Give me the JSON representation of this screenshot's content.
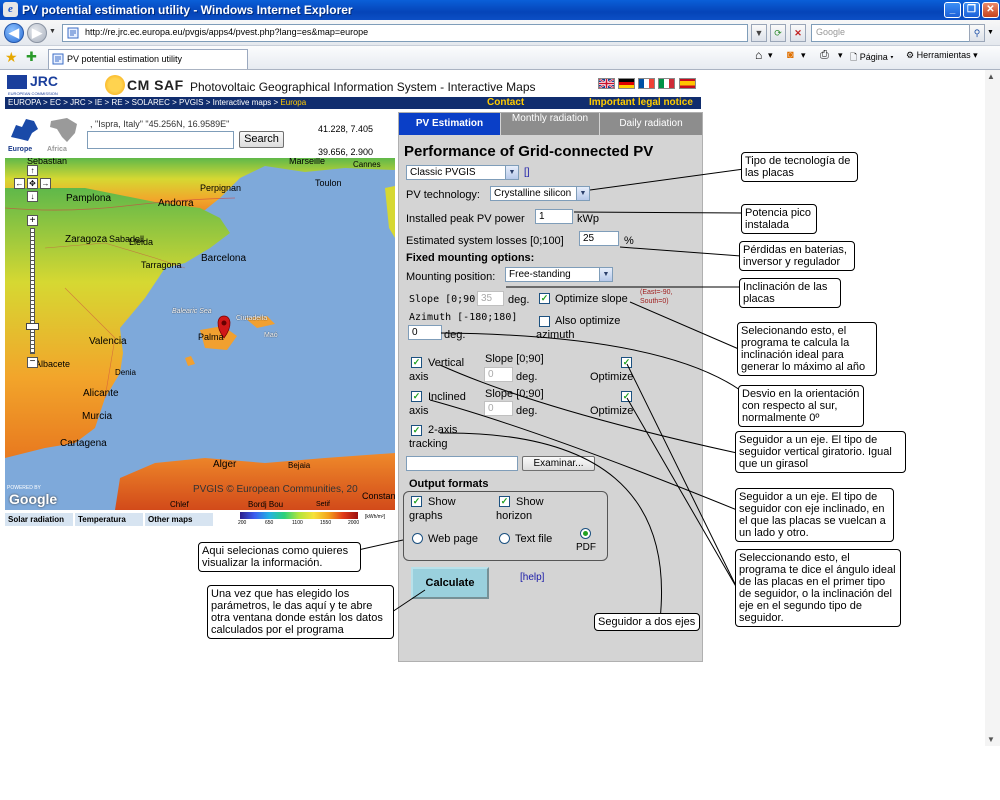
{
  "window": {
    "title": "PV potential estimation utility - Windows Internet Explorer",
    "url": "http://re.jrc.ec.europa.eu/pvgis/apps4/pvest.php?lang=es&map=europe",
    "search_placeholder": "Google",
    "tab_title": "PV potential estimation utility",
    "toolbar": {
      "page": "Página",
      "tools": "Herramientas"
    }
  },
  "header": {
    "jrc": "JRC",
    "jrc_sub": "EUROPEAN COMMISSION",
    "cmsaf": "CM SAF",
    "title": "Photovoltaic Geographical Information System - Interactive Maps",
    "breadcrumb": "EUROPA > EC > JRC > IE > RE > SOLAREC > PVGIS > Interactive maps > ",
    "breadcrumb_current": "Europa",
    "contact": "Contact",
    "legal": "Important legal notice"
  },
  "map_panel": {
    "region_europe": "Europe",
    "region_africa": "Africa",
    "search_hint": ", \"Ispra, Italy\" \"45.256N, 16.9589E\"",
    "search_button": "Search",
    "coord_top": "41.228, 7.405",
    "coord_bottom": "39.656, 2.900",
    "places": [
      "Sabadell",
      "Barcelona",
      "Andorra",
      "Zaragoza",
      "Lleida",
      "Tarragona",
      "Perpignan",
      "Toulon",
      "Pamplona",
      "Valencia",
      "Palma",
      "Ciutadella",
      "Maó",
      "Alicante",
      "Murcia",
      "Cartagena",
      "Albacete",
      "Denia",
      "Alger",
      "Bejaia",
      "Constan",
      "Chlef",
      "Bordj Bou",
      "Setif",
      "Balearic Sea",
      "Marseille",
      "Cannes",
      "Sebastian"
    ],
    "copyright": "PVGIS © European Communities, 20",
    "powered": "POWERED BY",
    "google": "Google",
    "tabs": [
      "Solar radiation",
      "Temperatura",
      "Other maps"
    ],
    "scale": [
      "200",
      "650",
      "1100",
      "1550",
      "2000",
      "[kWh/m²]"
    ]
  },
  "form": {
    "tabs": [
      "PV Estimation",
      "Monthly radiation",
      "Daily radiation"
    ],
    "title": "Performance of Grid-connected PV",
    "database": "Classic PVGIS",
    "database_help": "[]",
    "pv_technology_label": "PV technology:",
    "pv_technology": "Crystalline silicon",
    "peak_power_label": "Installed peak PV power",
    "peak_power": "1",
    "peak_power_unit": "kWp",
    "losses_label": "Estimated system losses [0;100]",
    "losses": "25",
    "losses_unit": "%",
    "fixed_header": "Fixed mounting options:",
    "mounting_label": "Mounting position:",
    "mounting": "Free-standing",
    "slope_label": "Slope [0;90]",
    "slope": "35",
    "deg": "deg.",
    "optimize_slope": "Optimize slope",
    "east_note_1": "(East=-90,",
    "east_note_2": "South=0)",
    "azimuth_label": "Azimuth [-180;180]",
    "azimuth": "0",
    "also_optimize": "Also optimize",
    "azimuth_word": "azimuth",
    "vertical_1": "Vertical",
    "vertical_2": "axis",
    "inclined_1": "Inclined",
    "inclined_2": "axis",
    "slope_short": "Slope [0;90]",
    "vert_slope": "0",
    "incl_slope": "0",
    "optimize": "Optimize",
    "twoaxis_1": "2-axis",
    "twoaxis_2": "tracking",
    "browse": "Examinar...",
    "output_header": "Output formats",
    "show_graphs_1": "Show",
    "show_graphs_2": "graphs",
    "show_horizon_1": "Show",
    "show_horizon_2": "horizon",
    "web_page": "Web page",
    "text_file": "Text file",
    "pdf": "PDF",
    "calculate": "Calculate",
    "help": "[help]"
  },
  "annotations": {
    "tech": "Tipo de tecnología de las placas",
    "peak": "Potencia pico instalada",
    "losses": "Pérdidas en baterias, inversor y regulador",
    "inclination": "Inclinación de las placas",
    "optimize_slope": "Selecionando esto, el programa te calcula la inclinación ideal para generar lo máximo al año",
    "azimuth": "Desvio en la orientación con respecto al sur, normalmente 0º",
    "vertical": "Seguidor a un eje. El tipo de seguidor vertical giratorio. Igual que un girasol",
    "inclined": "Seguidor a un eje. El tipo de seguidor con eje inclinado, en el que las placas se vuelcan a un lado y otro.",
    "optimize": "Seleccionando esto, el programa te dice el ángulo ideal de las placas en el primer tipo de seguidor, o la inclinación del eje en el segundo tipo de seguidor.",
    "two_axis": "Seguidor a dos ejes",
    "output": "Aqui selecionas como quieres visualizar la información.",
    "calculate": "Una vez que has elegido los parámetros, le das aquí y te abre otra ventana donde están los datos calculados por el programa"
  }
}
